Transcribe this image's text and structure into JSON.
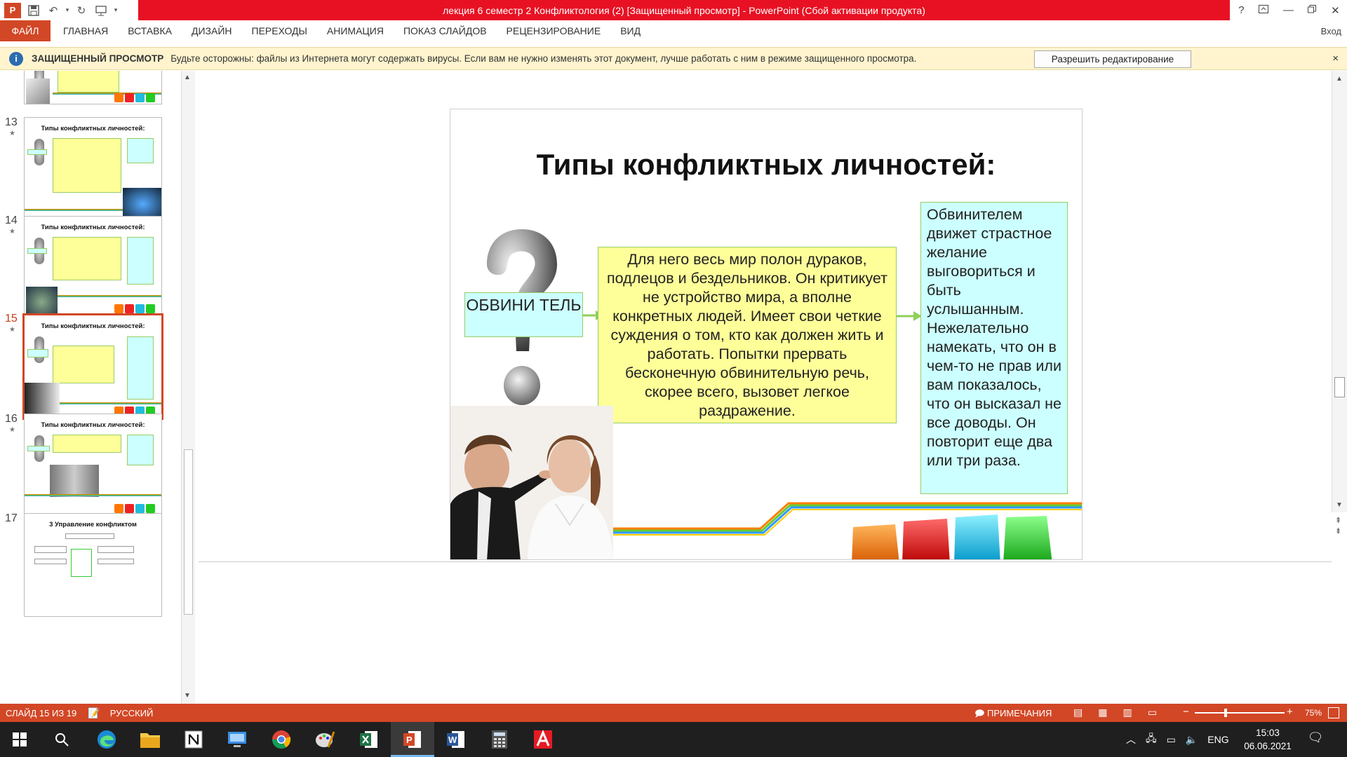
{
  "window": {
    "title": "лекция 6 семестр 2 Конфликтология (2) [Защищенный просмотр]  -  PowerPoint (Сбой активации продукта)",
    "app_logo": "P",
    "help": "?",
    "signin": "Вход"
  },
  "ribbon": {
    "file": "ФАЙЛ",
    "tabs": [
      "ГЛАВНАЯ",
      "ВСТАВКА",
      "ДИЗАЙН",
      "ПЕРЕХОДЫ",
      "АНИМАЦИЯ",
      "ПОКАЗ СЛАЙДОВ",
      "РЕЦЕНЗИРОВАНИЕ",
      "ВИД"
    ]
  },
  "protected_view": {
    "title": "ЗАЩИЩЕННЫЙ ПРОСМОТР",
    "message": "Будьте осторожны: файлы из Интернета могут содержать вирусы. Если вам не нужно изменять этот документ, лучше работать с ним в режиме защищенного просмотра.",
    "enable_button": "Разрешить редактирование",
    "close": "×"
  },
  "thumbnails": {
    "items": [
      {
        "number": "13",
        "title": "Типы конфликтных личностей:"
      },
      {
        "number": "14",
        "title": "Типы конфликтных личностей:"
      },
      {
        "number": "15",
        "title": "Типы конфликтных личностей:"
      },
      {
        "number": "16",
        "title": "Типы конфликтных личностей:"
      },
      {
        "number": "17",
        "title": "3 Управление конфликтом"
      }
    ],
    "active": "15"
  },
  "slide": {
    "title": "Типы конфликтных личностей:",
    "label": "ОБВИНИ ТЕЛЬ",
    "yellow_text": "Для него весь мир полон дураков, подлецов и бездельников. Он критикует не устройство мира, а вполне конкретных людей. Имеет свои четкие суждения о том, кто как должен жить и работать. Попытки прервать бесконечную обвинительную речь, скорее всего, вызовет легкое раздражение.",
    "cyan_text": "Обвинителем движет страстное желание выговориться и быть услышанным. Нежелательно намекать, что он в чем-то не прав или вам показалось, что он высказал не все доводы. Он повторит еще два или три раза."
  },
  "status": {
    "slide_counter": "СЛАЙД 15 ИЗ 19",
    "language": "РУССКИЙ",
    "notes": "ПРИМЕЧАНИЯ",
    "zoom": "75%",
    "zoom_level": 0.34
  },
  "taskbar": {
    "lang": "ENG",
    "time": "15:03",
    "date": "06.06.2021"
  },
  "colors": {
    "accent": "#d24726",
    "title_red": "#e81123",
    "yellow_box": "#ffff99",
    "cyan_box": "#ccffff",
    "pv_bar": "#fff4ce"
  }
}
